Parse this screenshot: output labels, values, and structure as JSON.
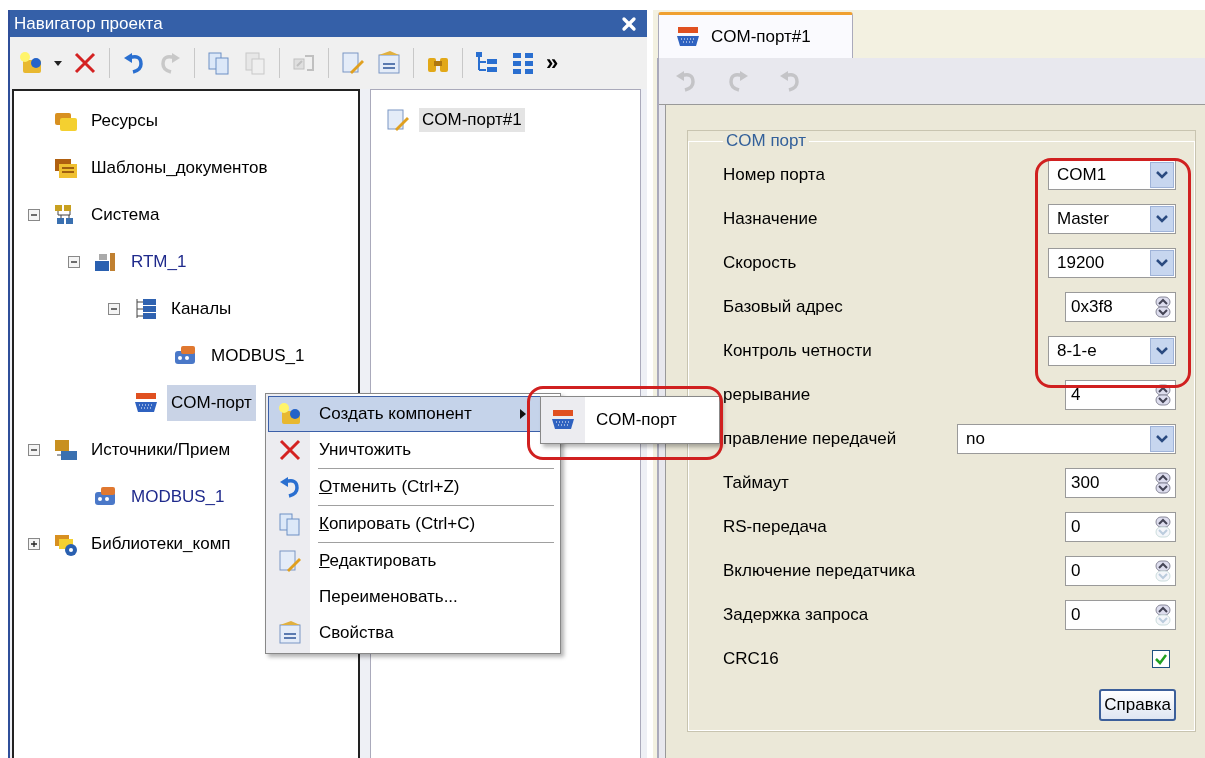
{
  "navigator": {
    "title": "Навигатор проекта",
    "toolbar": [
      {
        "kind": "new-item",
        "disabled": false
      },
      {
        "kind": "dropdown",
        "disabled": false
      },
      {
        "kind": "delete",
        "disabled": false
      },
      {
        "kind": "separator"
      },
      {
        "kind": "undo",
        "disabled": false
      },
      {
        "kind": "redo",
        "disabled": true
      },
      {
        "kind": "separator"
      },
      {
        "kind": "copy",
        "disabled": false
      },
      {
        "kind": "paste",
        "disabled": true
      },
      {
        "kind": "separator"
      },
      {
        "kind": "link",
        "disabled": true
      },
      {
        "kind": "separator"
      },
      {
        "kind": "edit",
        "disabled": false
      },
      {
        "kind": "properties",
        "disabled": false
      },
      {
        "kind": "separator"
      },
      {
        "kind": "find",
        "disabled": false
      },
      {
        "kind": "separator"
      },
      {
        "kind": "tree-view",
        "disabled": false
      },
      {
        "kind": "grid-view",
        "disabled": false
      }
    ],
    "overflow": "»",
    "tree": [
      {
        "label": "Ресурсы",
        "kind": "folder",
        "color": "#000000",
        "selected": false
      },
      {
        "label": "Шаблоны_документов",
        "kind": "templates",
        "color": "#000000",
        "selected": false
      },
      {
        "label": "Система",
        "kind": "system",
        "color": "#000000",
        "selected": false,
        "expanded": true,
        "children": [
          {
            "label": "RTM_1",
            "kind": "station",
            "color": "#1f2a8c",
            "selected": false,
            "expanded": true,
            "children": [
              {
                "label": "Каналы",
                "kind": "channels",
                "color": "#000000",
                "selected": false,
                "expanded": true,
                "children": [
                  {
                    "label": "MODBUS_1",
                    "kind": "protocol",
                    "color": "#000000",
                    "selected": false
                  }
                ]
              },
              {
                "label": "COM-порт",
                "kind": "port",
                "color": "#000000",
                "selected": true
              }
            ]
          }
        ]
      },
      {
        "label": "Источники/Прием",
        "kind": "io",
        "color": "#000000",
        "selected": false,
        "expanded": true,
        "children": [
          {
            "label": "MODBUS_1",
            "kind": "protocol",
            "color": "#1f2a8c",
            "selected": false
          }
        ]
      },
      {
        "label": "Библиотеки_комп",
        "kind": "library",
        "color": "#000000",
        "selected": false,
        "expanded": false
      }
    ],
    "list": [
      {
        "label": "COM-порт#1",
        "selected": true
      }
    ]
  },
  "editor": {
    "tabs": [
      {
        "label": "COM-порт#1",
        "selected": true
      }
    ],
    "toolbar": [
      {
        "kind": "undo",
        "disabled": true
      },
      {
        "kind": "redo",
        "disabled": true
      },
      {
        "kind": "undo-all",
        "disabled": true
      }
    ],
    "group_title": "COM порт",
    "fields": [
      {
        "kind": "select",
        "label": "Номер порта",
        "value": "COM1"
      },
      {
        "kind": "select",
        "label": "Назначение",
        "value": "Master"
      },
      {
        "kind": "select",
        "label": "Скорость",
        "value": "19200"
      },
      {
        "kind": "spin",
        "label": "Базовый адрес",
        "value": "0x3f8",
        "down_enabled": true
      },
      {
        "kind": "select",
        "label": "Контроль четности",
        "value": "8-1-e"
      },
      {
        "kind": "spin",
        "label": "рерывание",
        "value": "4",
        "down_enabled": true
      },
      {
        "kind": "wide-select",
        "label": "правление передачей",
        "value": "no"
      },
      {
        "kind": "spin",
        "label": "Таймаут",
        "value": "300",
        "down_enabled": true
      },
      {
        "kind": "spin",
        "label": "RS-передача",
        "value": "0",
        "down_enabled": false
      },
      {
        "kind": "spin",
        "label": "Включение передатчика",
        "value": "0",
        "down_enabled": false
      },
      {
        "kind": "spin",
        "label": "Задержка запроса",
        "value": "0",
        "down_enabled": false
      },
      {
        "kind": "checkbox",
        "label": "CRC16",
        "checked": true
      }
    ],
    "help_button": "Справка"
  },
  "context_menu": {
    "items": [
      {
        "kind": "item",
        "label": "Создать компонент",
        "underlined_first": false,
        "submenu": true,
        "selected": true
      },
      {
        "kind": "item",
        "label": "Уничтожить",
        "underlined_first": false,
        "submenu": false,
        "selected": false
      },
      {
        "kind": "separator"
      },
      {
        "kind": "item",
        "label": "Отменить (Ctrl+Z)",
        "underlined_first": true,
        "submenu": false,
        "selected": false
      },
      {
        "kind": "separator"
      },
      {
        "kind": "item",
        "label": "Копировать (Ctrl+C)",
        "underlined_first": true,
        "submenu": false,
        "selected": false
      },
      {
        "kind": "separator"
      },
      {
        "kind": "item",
        "label": "Редактировать",
        "underlined_first": true,
        "submenu": false,
        "selected": false
      },
      {
        "kind": "item",
        "label": "Переименовать...",
        "underlined_first": false,
        "submenu": false,
        "selected": false
      },
      {
        "kind": "item",
        "label": "Свойства",
        "underlined_first": false,
        "submenu": false,
        "selected": false
      }
    ],
    "submenu": [
      {
        "label": "COM-порт"
      }
    ]
  }
}
